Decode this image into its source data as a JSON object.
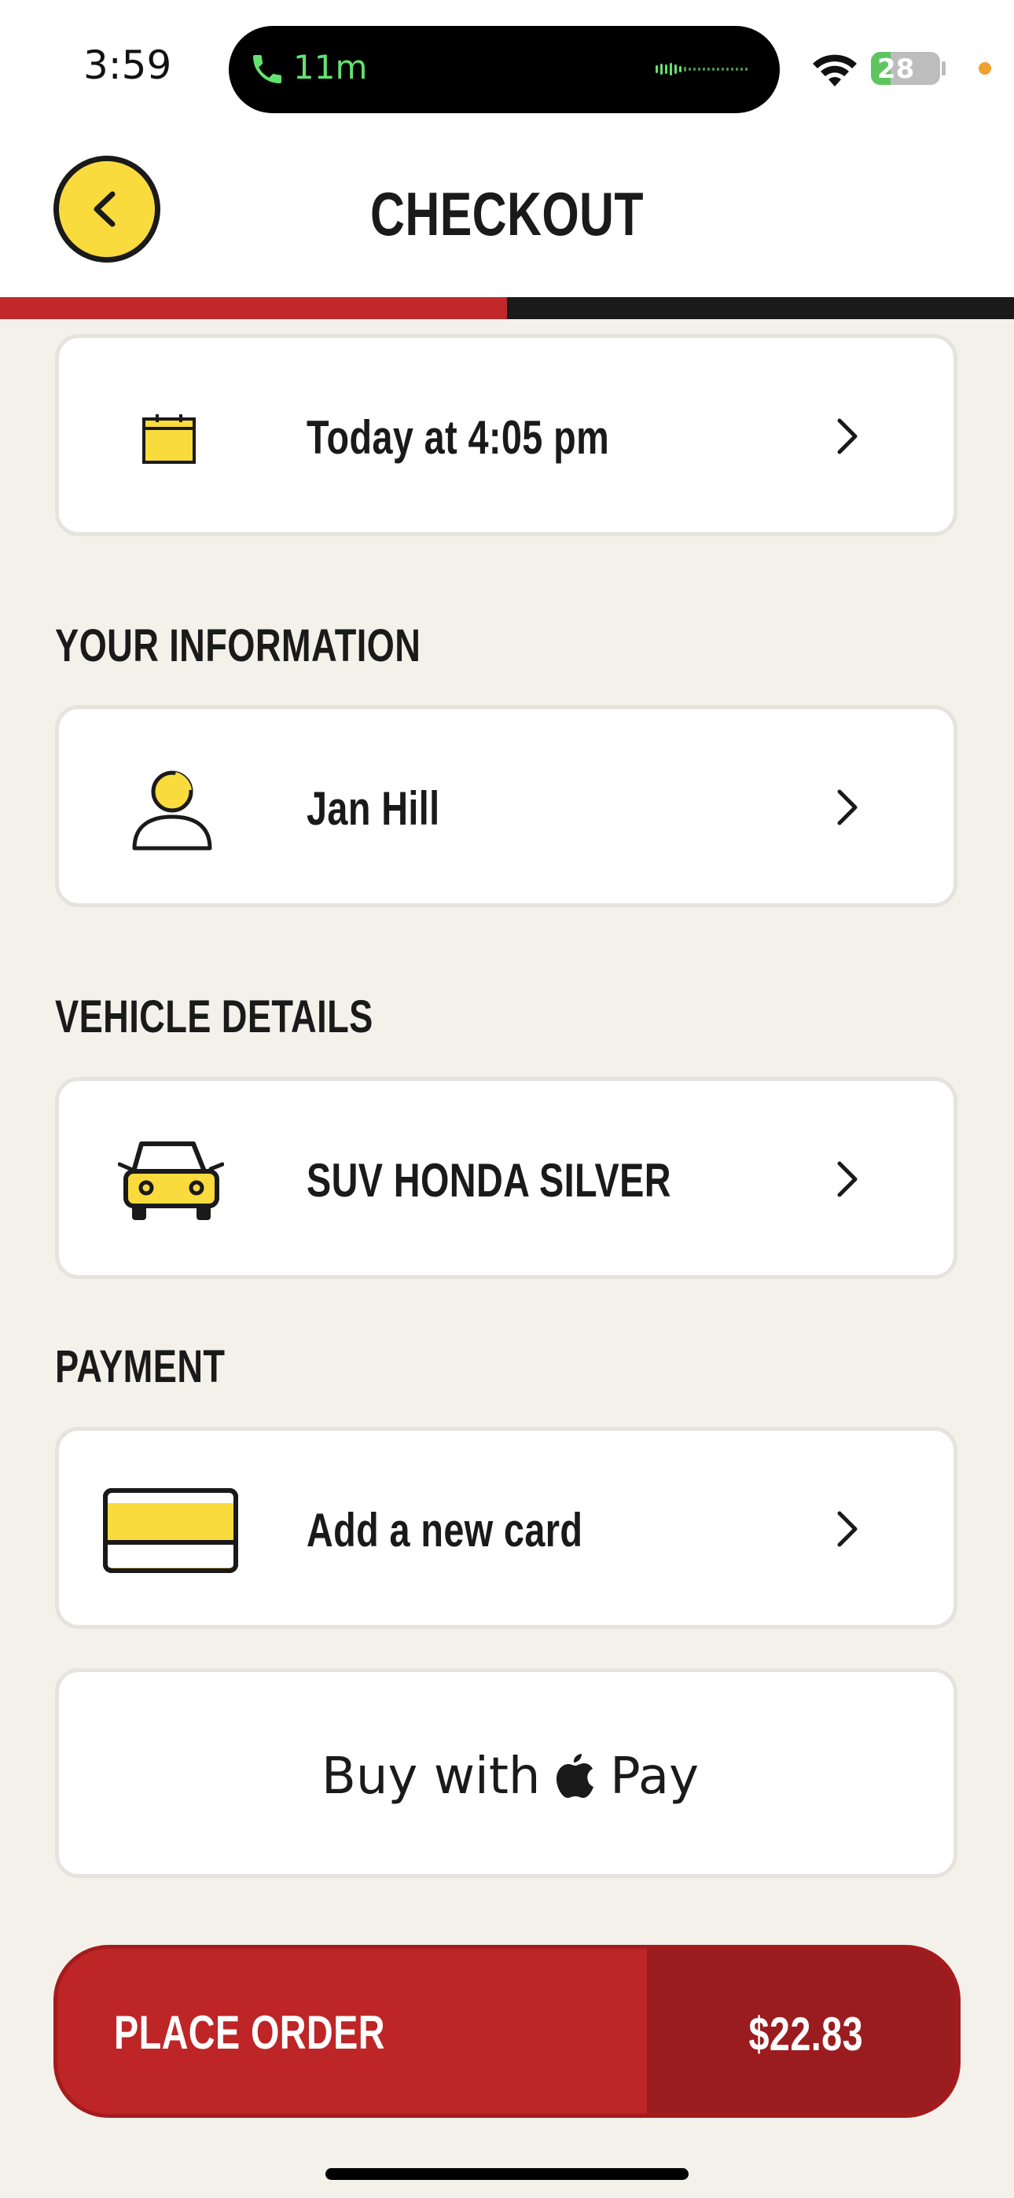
{
  "status_bar": {
    "time": "3:59",
    "call_duration": "11m",
    "battery_level": "28",
    "battery_fraction": 0.28
  },
  "header": {
    "title": "CHECKOUT",
    "progress_fraction": 0.5
  },
  "pickup_time": {
    "label": "Today at 4:05 pm",
    "icon": "calendar-icon"
  },
  "your_information": {
    "heading": "YOUR INFORMATION",
    "name": "Jan Hill",
    "icon": "person-icon"
  },
  "vehicle_details": {
    "heading": "VEHICLE DETAILS",
    "vehicle": "SUV HONDA SILVER",
    "icon": "car-icon"
  },
  "payment": {
    "heading": "PAYMENT",
    "add_card_label": "Add a new card",
    "apple_pay_prefix": "Buy with",
    "apple_pay_suffix": "Pay"
  },
  "place_order": {
    "label": "PLACE ORDER",
    "total": "$22.83"
  },
  "colors": {
    "accent_yellow": "#fadb3e",
    "brand_red": "#be2527",
    "dark_red": "#9b1c1f",
    "background": "#f4f1eb"
  }
}
